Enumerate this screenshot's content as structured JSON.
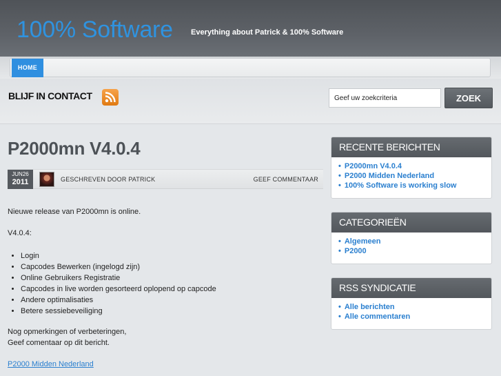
{
  "header": {
    "site_title": "100% Software",
    "tagline": "Everything about Patrick & 100% Software"
  },
  "nav": {
    "items": [
      {
        "label": "HOME",
        "active": true
      }
    ]
  },
  "contact": {
    "label": "BLIJF IN CONTACT",
    "rss_icon": "rss-feed-icon"
  },
  "search": {
    "placeholder": "Geef uw zoekcriteria",
    "button_label": "ZOEK"
  },
  "post": {
    "title": "P2000mn V4.0.4",
    "date_month_day": "JUN26",
    "date_year": "2011",
    "author_line": "GESCHREVEN DOOR PATRICK",
    "comment_link": "GEEF COMMENTAAR",
    "intro": "Nieuwe release van P2000mn is online.",
    "version_heading": "V4.0.4:",
    "features": [
      "Login",
      "Capcodes Bewerken (ingelogd zijn)",
      "Online Gebruikers Registratie",
      "Capcodes in live worden gesorteerd oplopend op capcode",
      "Andere optimalisaties",
      "Betere sessiebeveiliging"
    ],
    "closing_line1": "Nog opmerkingen of verbeteringen,",
    "closing_line2": "Geef comentaar op dit bericht.",
    "related_link": "P2000 Midden Nederland"
  },
  "sidebar": {
    "recent": {
      "title": "RECENTE BERICHTEN",
      "items": [
        "P2000mn V4.0.4",
        "P2000 Midden Nederland",
        "100% Software is working slow"
      ]
    },
    "categories": {
      "title": "CATEGORIEËN",
      "items": [
        "Algemeen",
        "P2000"
      ]
    },
    "rss": {
      "title": "RSS SYNDICATIE",
      "items": [
        "Alle berichten",
        "Alle commentaren"
      ]
    }
  },
  "colors": {
    "accent": "#2f8fe0",
    "link": "#2a7fcf",
    "header_bg": "#55595e",
    "rss_orange": "#f08a1c"
  }
}
